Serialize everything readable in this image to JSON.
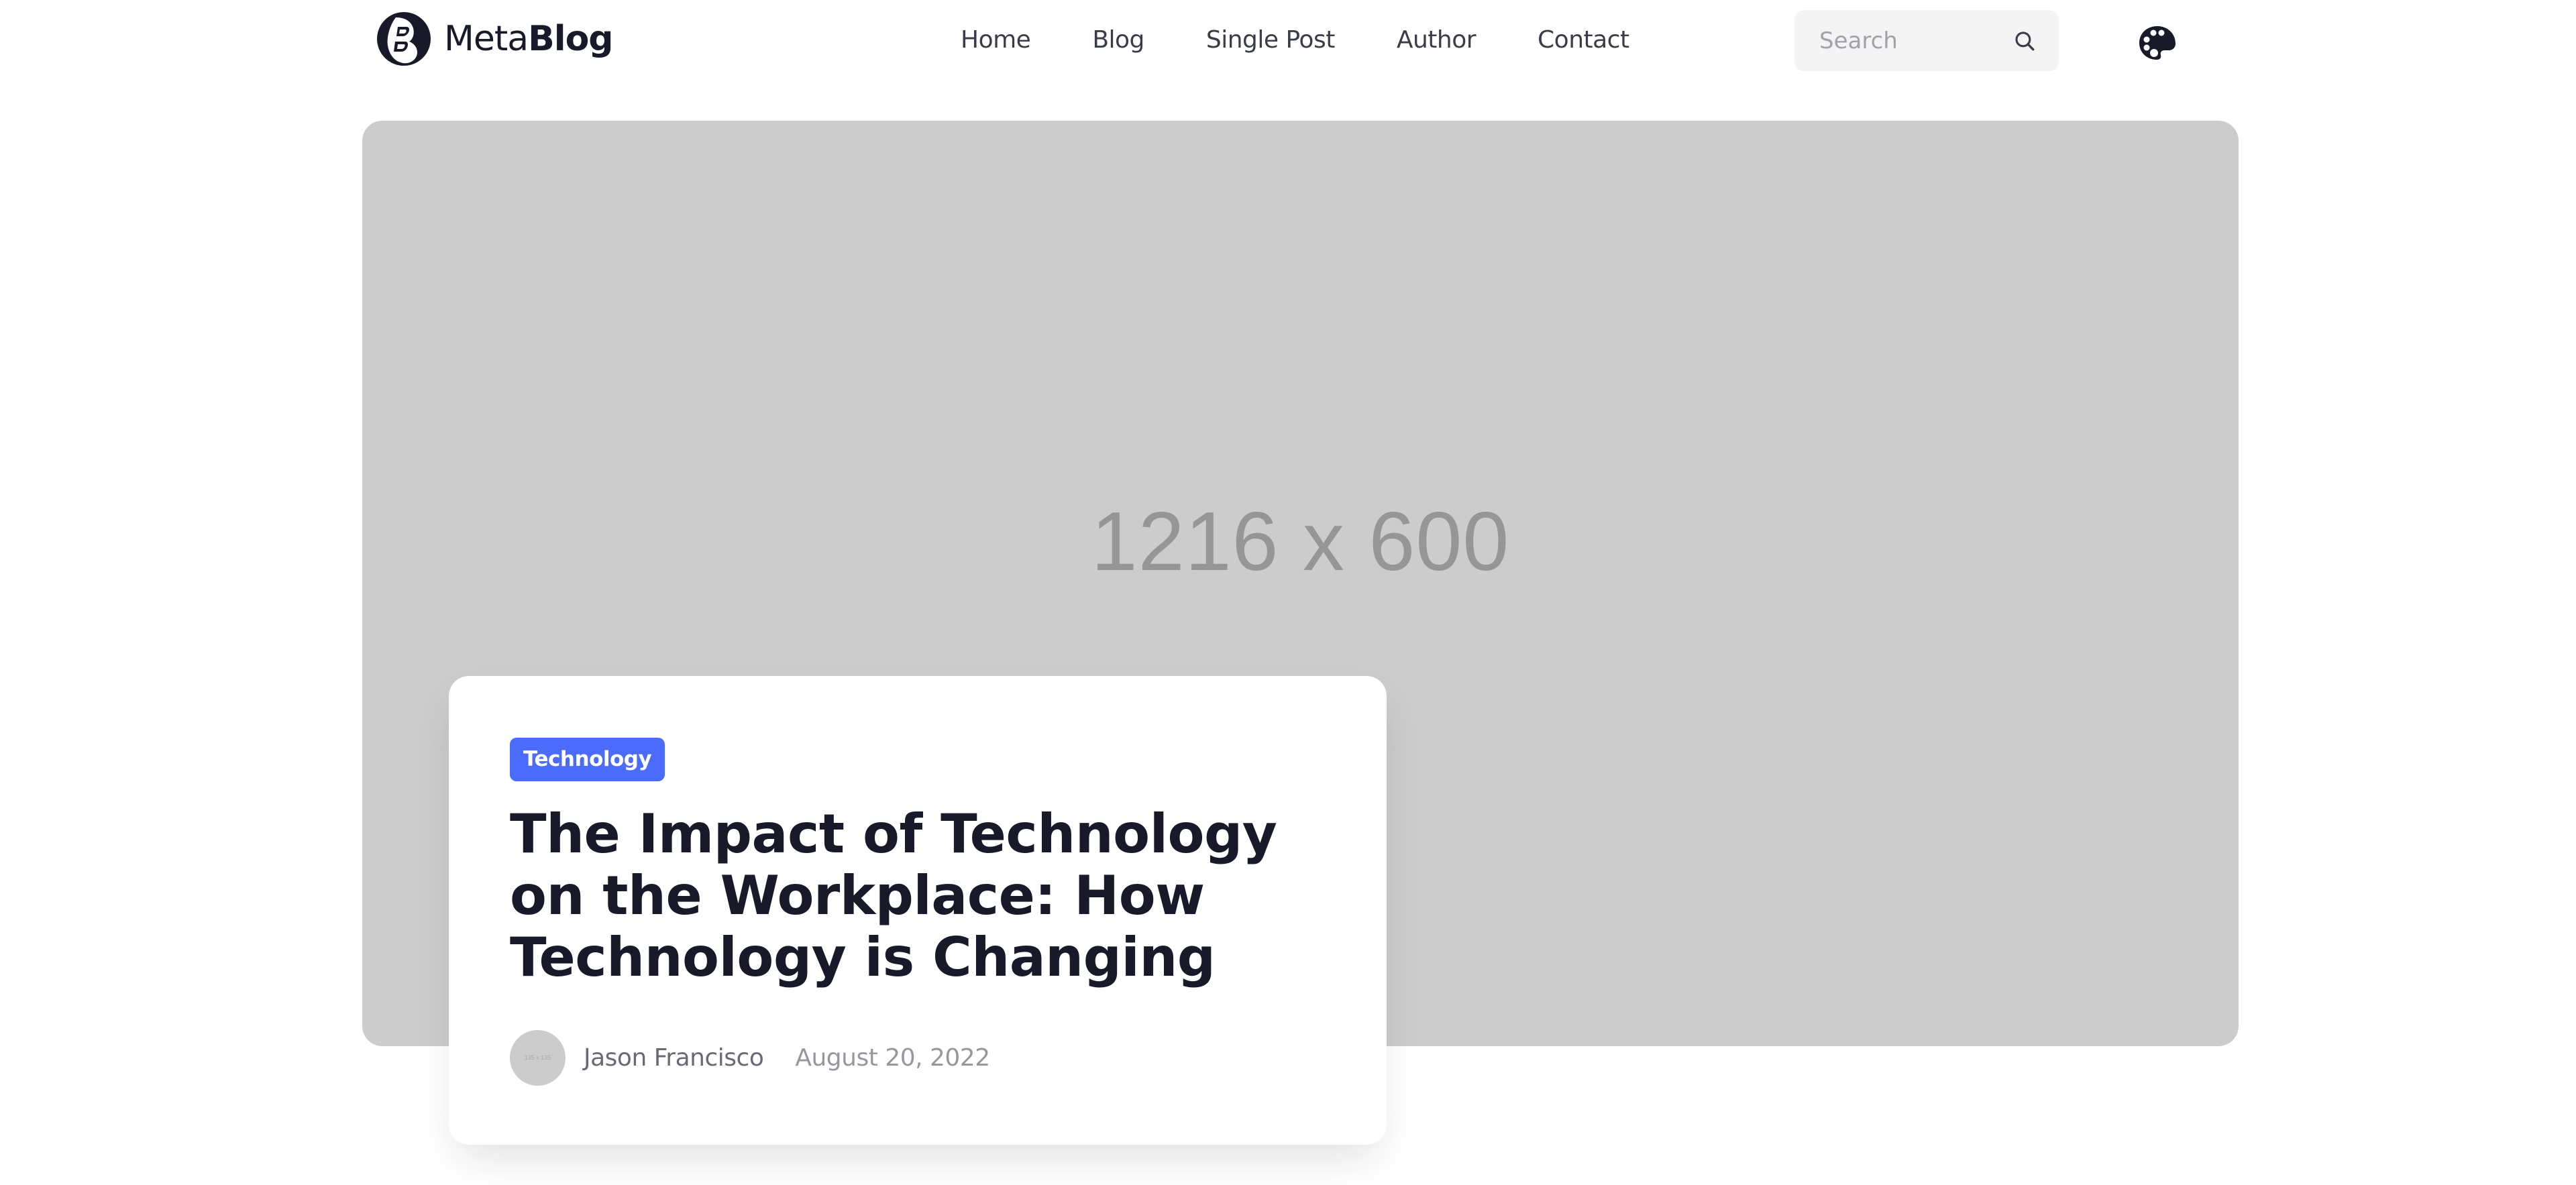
{
  "brand": {
    "name_light": "Meta",
    "name_bold": "Blog",
    "logo_icon": "b-circle-logo-icon"
  },
  "nav": {
    "items": [
      {
        "label": "Home"
      },
      {
        "label": "Blog"
      },
      {
        "label": "Single Post"
      },
      {
        "label": "Author"
      },
      {
        "label": "Contact"
      }
    ]
  },
  "search": {
    "placeholder": "Search",
    "value": "",
    "icon": "search-icon"
  },
  "theme_toggle": {
    "icon": "palette-icon"
  },
  "hero": {
    "placeholder_text": "1216 x 600",
    "background": "#cccccc"
  },
  "featured_post": {
    "category": "Technology",
    "category_color": "#4b6bfb",
    "title": "The Impact of Technology on the Workplace: How Technology is Changing",
    "author": {
      "name": "Jason Francisco",
      "avatar_placeholder": "135 x 135"
    },
    "date": "August 20, 2022"
  },
  "colors": {
    "text_primary": "#181a2a",
    "text_nav": "#3b3c4a",
    "text_muted": "#696a75",
    "text_date": "#97989f",
    "search_bg": "#f4f4f5"
  }
}
